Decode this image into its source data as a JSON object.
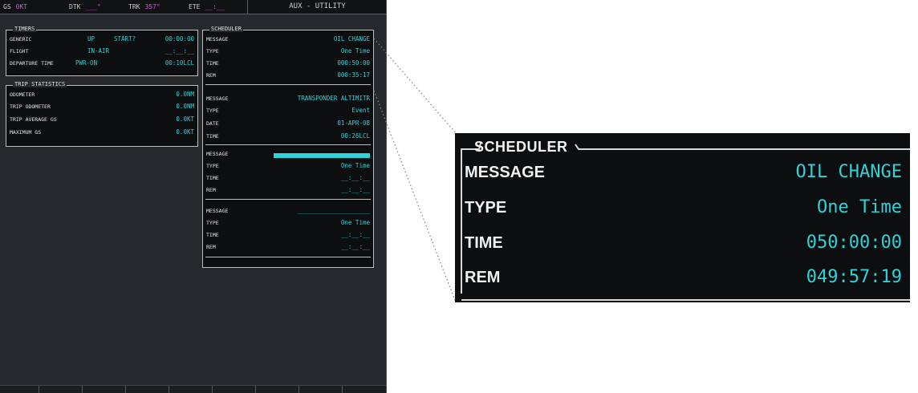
{
  "topbar": {
    "gs_label": "GS",
    "gs_value": "0KT",
    "dtk_label": "DTK",
    "dtk_value": "___°",
    "trk_label": "TRK",
    "trk_value": "357°",
    "ete_label": "ETE",
    "ete_value": "__:__",
    "page_title": "AUX - UTILITY"
  },
  "timers": {
    "title": "TIMERS",
    "rows": [
      {
        "label": "GENERIC",
        "mid1": "UP",
        "mid2": "START?",
        "value": "00:00:00"
      },
      {
        "label": "FLIGHT",
        "mid1": "IN-AIR",
        "mid2": "",
        "value": "__:__:__"
      },
      {
        "label": "DEPARTURE TIME",
        "mid1": "PWR-ON",
        "mid2": "",
        "value": "00:10LCL"
      }
    ]
  },
  "trip": {
    "title": "TRIP STATISTICS",
    "rows": [
      {
        "label": "ODOMETER",
        "value": "0.0NM"
      },
      {
        "label": "TRIP ODOMETER",
        "value": "0.0NM"
      },
      {
        "label": "TRIP AVERAGE GS",
        "value": "0.0KT"
      },
      {
        "label": "MAXIMUM GS",
        "value": "0.0KT"
      }
    ]
  },
  "scheduler": {
    "title": "SCHEDULER",
    "entries": [
      {
        "rows": [
          {
            "label": "MESSAGE",
            "value": "OIL CHANGE"
          },
          {
            "label": "TYPE",
            "value": "One Time"
          },
          {
            "label": "TIME",
            "value": "000:50:00"
          },
          {
            "label": "REM",
            "value": "000:35:17"
          }
        ]
      },
      {
        "rows": [
          {
            "label": "MESSAGE",
            "value": "TRANSPONDER ALTIMITR"
          },
          {
            "label": "TYPE",
            "value": "Event"
          },
          {
            "label": "DATE",
            "value": "01-APR-08"
          },
          {
            "label": "TIME",
            "value": "00:26LCL"
          }
        ]
      },
      {
        "rows": [
          {
            "label": "MESSAGE",
            "value": ""
          },
          {
            "label": "TYPE",
            "value": "One Time"
          },
          {
            "label": "TIME",
            "value": "__:__:__"
          },
          {
            "label": "REM",
            "value": "__:__:__"
          }
        ]
      },
      {
        "rows": [
          {
            "label": "MESSAGE",
            "value": "____________________"
          },
          {
            "label": "TYPE",
            "value": "One Time"
          },
          {
            "label": "TIME",
            "value": "__:__:__"
          },
          {
            "label": "REM",
            "value": "__:__:__"
          }
        ]
      }
    ]
  },
  "zoom": {
    "title": "SCHEDULER",
    "rows": [
      {
        "label": "MESSAGE",
        "value": "OIL CHANGE"
      },
      {
        "label": "TYPE",
        "value": "One Time"
      },
      {
        "label": "TIME",
        "value": "050:00:00"
      },
      {
        "label": "REM",
        "value": "049:57:19"
      }
    ]
  },
  "colors": {
    "accent_cyan": "#2ed3d9",
    "magenta": "#d25ad2",
    "screen_bg": "#26292c"
  }
}
